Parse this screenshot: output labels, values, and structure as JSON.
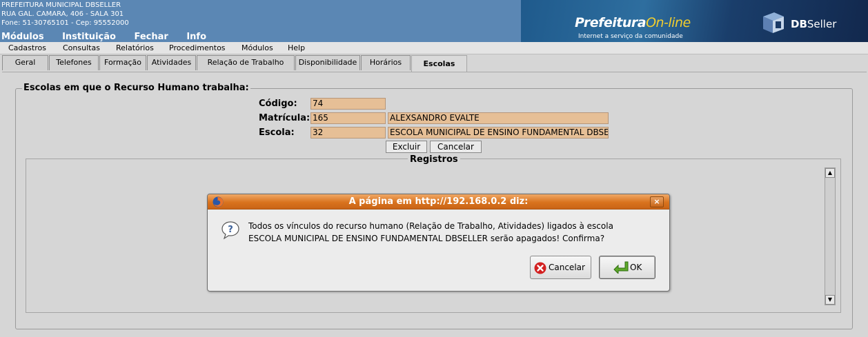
{
  "header": {
    "org_lines": [
      "PREFEITURA MUNICIPAL DBSELLER",
      "RUA GAL. CAMARA, 406 - SALA 301",
      "Fone: 51-30765101  -  Cep: 95552000"
    ],
    "nav": [
      "Módulos",
      "Instituição",
      "Fechar",
      "Info"
    ],
    "logo_prefeitura": "Prefeitura",
    "logo_online": "On-line",
    "logo_tagline": "Internet a serviço da comunidade",
    "logo_db": "DB",
    "logo_seller": "Seller"
  },
  "menubar": [
    "Cadastros",
    "Consultas",
    "Relatórios",
    "Procedimentos",
    "Módulos",
    "Help"
  ],
  "tabs": [
    "Geral",
    "Telefones",
    "Formação",
    "Atividades",
    "Relação de Trabalho",
    "Disponibilidade",
    "Horários",
    "Escolas"
  ],
  "active_tab": "Escolas",
  "form": {
    "legend": "Escolas em que o Recurso Humano trabalha:",
    "codigo_label": "Código:",
    "codigo_value": "74",
    "matricula_label": "Matrícula:",
    "matricula_value": "165",
    "matricula_name": "ALEXSANDRO EVALTE",
    "escola_label": "Escola:",
    "escola_value": "32",
    "escola_name": "ESCOLA MUNICIPAL DE ENSINO FUNDAMENTAL DBSELLER",
    "excluir_label": "Excluir",
    "cancelar_label": "Cancelar",
    "registros_label": "Registros"
  },
  "dialog": {
    "title": "A página em http://192.168.0.2 diz:",
    "close_glyph": "×",
    "message_line1": "Todos os vínculos do recurso humano (Relação de Trabalho, Atividades) ligados à escola",
    "message_line2": "ESCOLA MUNICIPAL DE ENSINO FUNDAMENTAL DBSELLER serão apagados! Confirma?",
    "cancel_label": "Cancelar",
    "ok_label": "OK"
  },
  "colors": {
    "header_bg": "#5b87b4",
    "input_bg": "#e6bf96",
    "dialog_title": "#d9731e"
  }
}
